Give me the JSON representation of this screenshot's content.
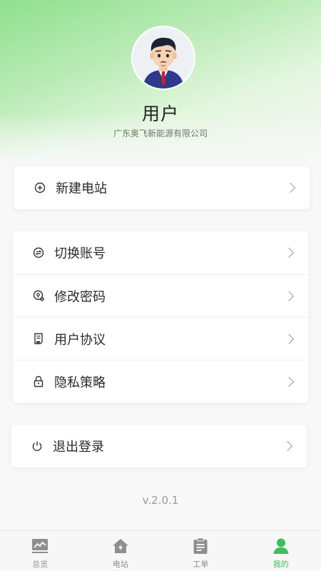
{
  "profile": {
    "name": "用户",
    "company": "广东奥飞新能源有限公司"
  },
  "menu": {
    "group1": [
      {
        "label": "新建电站",
        "icon": "plus-circle-icon"
      }
    ],
    "group2": [
      {
        "label": "切换账号",
        "icon": "switch-account-icon"
      },
      {
        "label": "修改密码",
        "icon": "password-icon"
      },
      {
        "label": "用户协议",
        "icon": "document-icon"
      },
      {
        "label": "隐私策略",
        "icon": "lock-icon"
      }
    ],
    "group3": [
      {
        "label": "退出登录",
        "icon": "power-icon"
      }
    ]
  },
  "version": "v.2.0.1",
  "tabbar": {
    "active_color": "#3ac05c",
    "inactive_color": "#8e8e8e",
    "tabs": [
      {
        "label": "总览",
        "icon": "overview-chart-icon",
        "active": false
      },
      {
        "label": "电站",
        "icon": "station-home-icon",
        "active": false
      },
      {
        "label": "工单",
        "icon": "clipboard-icon",
        "active": false
      },
      {
        "label": "我的",
        "icon": "user-icon",
        "active": true
      }
    ]
  }
}
